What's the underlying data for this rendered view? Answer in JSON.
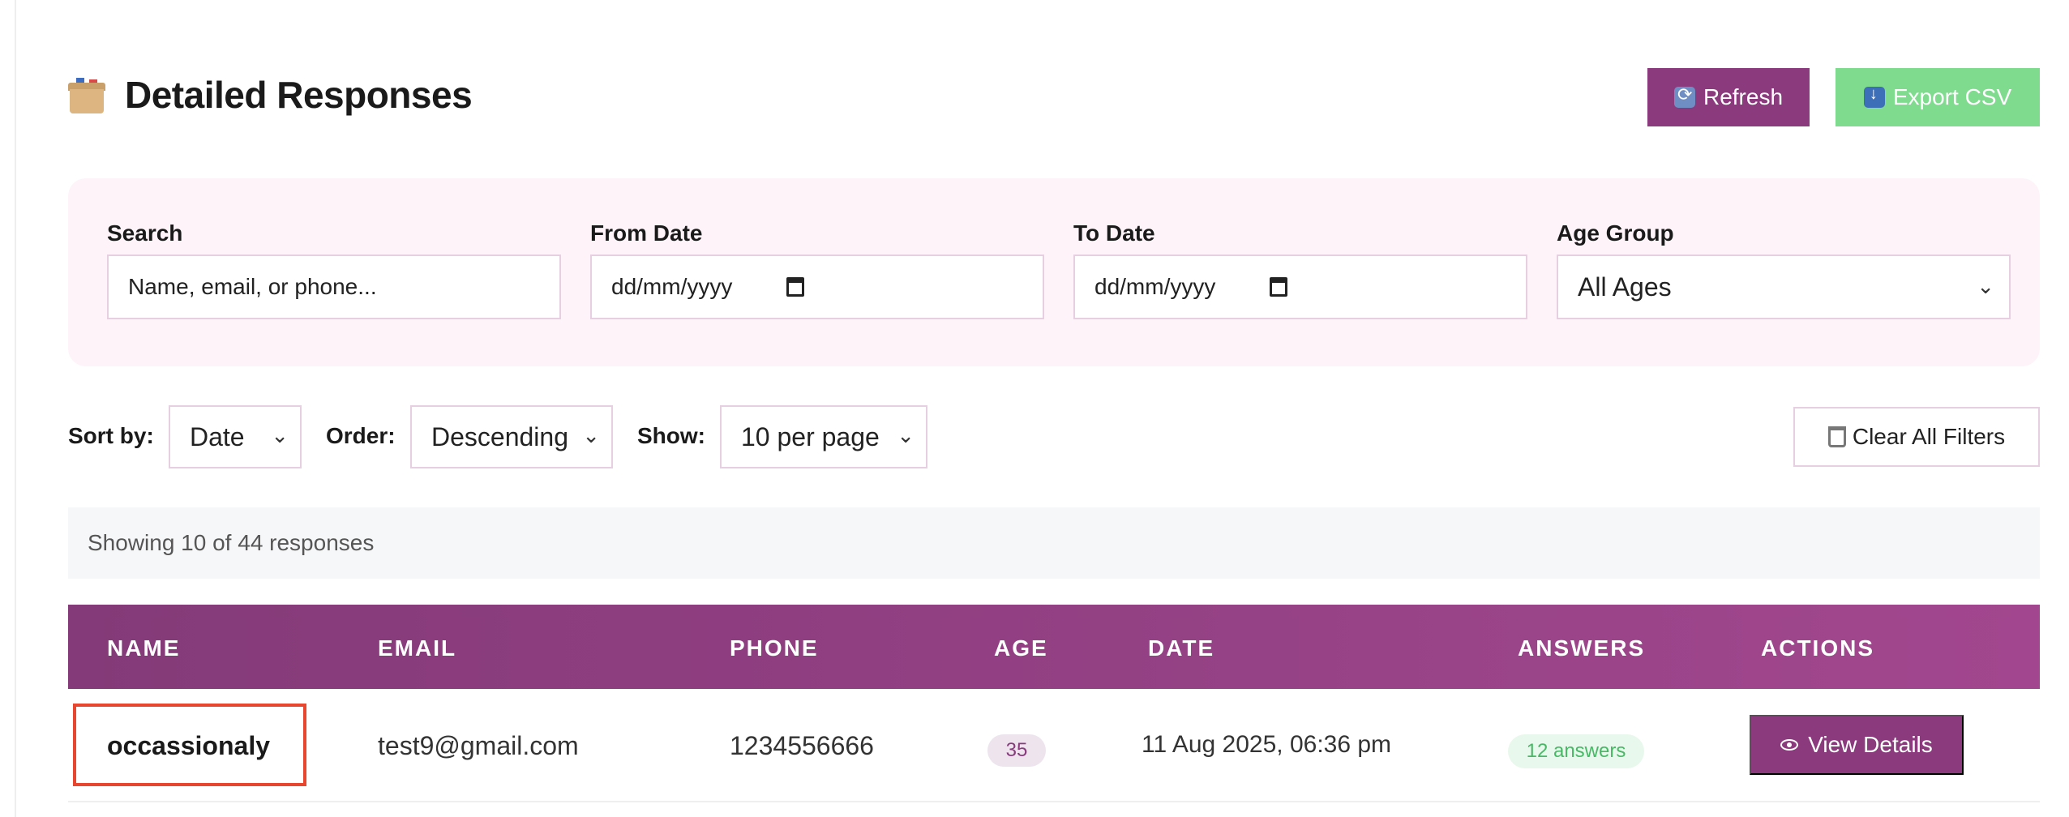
{
  "header": {
    "title": "Detailed Responses",
    "title_icon": "card-file-box-icon",
    "refresh_label": "Refresh",
    "export_label": "Export CSV"
  },
  "filters": {
    "search": {
      "label": "Search",
      "placeholder": "Name, email, or phone..."
    },
    "from_date": {
      "label": "From Date",
      "value": "dd/mm/yyyy"
    },
    "to_date": {
      "label": "To Date",
      "value": "dd/mm/yyyy"
    },
    "age_group": {
      "label": "Age Group",
      "value": "All Ages"
    }
  },
  "controls": {
    "sort_label": "Sort by:",
    "sort_value": "Date",
    "order_label": "Order:",
    "order_value": "Descending",
    "show_label": "Show:",
    "show_value": "10 per page",
    "clear_label": "Clear All Filters"
  },
  "summary": {
    "text": "Showing 10 of 44 responses"
  },
  "table": {
    "columns": [
      "NAME",
      "EMAIL",
      "PHONE",
      "AGE",
      "DATE",
      "ANSWERS",
      "ACTIONS"
    ],
    "rows": [
      {
        "name": "occassionaly",
        "email": "test9@gmail.com",
        "phone": "1234556666",
        "age": "35",
        "date": "11 Aug 2025, 06:36 pm",
        "answers": "12 answers",
        "action": "View Details"
      }
    ]
  },
  "colors": {
    "primary": "#8a3a7d",
    "export": "#7fdc8f",
    "highlight": "#e8462e"
  }
}
